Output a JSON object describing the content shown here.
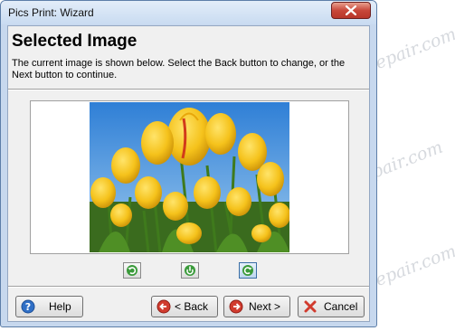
{
  "window": {
    "title": "Pics Print: Wizard"
  },
  "header": {
    "heading": "Selected Image",
    "description": "The current image is shown below.  Select the Back button to change, or the Next button to continue."
  },
  "rotate_controls": [
    {
      "icon": "rotate-left-icon"
    },
    {
      "icon": "flip-icon"
    },
    {
      "icon": "rotate-right-icon"
    }
  ],
  "buttons": {
    "help": "Help",
    "back": "< Back",
    "next": "Next >",
    "cancel": "Cancel"
  },
  "watermark": "Soringpcrepair.com",
  "colors": {
    "help_icon": "#2f6fc6",
    "back_icon": "#d13b2e",
    "cancel_icon": "#d13b2e",
    "rotate_icon": "#3a9a3a",
    "close_button": "#c8473a"
  }
}
